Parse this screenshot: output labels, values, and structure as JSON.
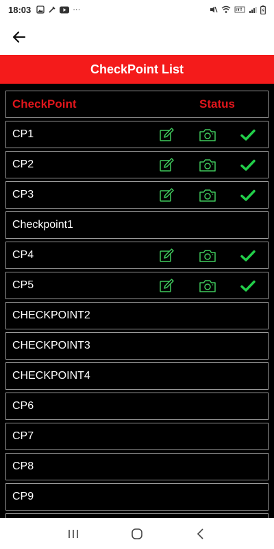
{
  "status_bar": {
    "time": "18:03",
    "left_icons": [
      "gallery-icon",
      "tools-icon",
      "youtube-icon",
      "more-icon"
    ],
    "right_icons": [
      "mute-icon",
      "wifi-icon",
      "volte-icon",
      "signal-icon",
      "battery-icon"
    ],
    "more": "···"
  },
  "app_bar": {
    "back_icon": "arrow-left-icon"
  },
  "title": "CheckPoint List",
  "table": {
    "header": {
      "checkpoint": "CheckPoint",
      "status": "Status"
    },
    "rows": [
      {
        "name": "CP1",
        "done": true
      },
      {
        "name": "CP2",
        "done": true
      },
      {
        "name": "CP3",
        "done": true
      },
      {
        "name": "Checkpoint1",
        "done": false
      },
      {
        "name": "CP4",
        "done": true
      },
      {
        "name": "CP5",
        "done": true
      },
      {
        "name": "CHECKPOINT2",
        "done": false
      },
      {
        "name": "CHECKPOINT3",
        "done": false
      },
      {
        "name": "CHECKPOINT4",
        "done": false
      },
      {
        "name": "CP6",
        "done": false
      },
      {
        "name": "CP7",
        "done": false
      },
      {
        "name": "CP8",
        "done": false
      },
      {
        "name": "CP9",
        "done": false
      },
      {
        "name": "",
        "done": false
      }
    ]
  },
  "colors": {
    "accent": "#f41b1b",
    "header_text": "#e0161c",
    "icon_green": "#3fc95c",
    "check_green": "#22d04a"
  },
  "nav_bar": [
    "recents-icon",
    "home-icon",
    "back-icon"
  ]
}
